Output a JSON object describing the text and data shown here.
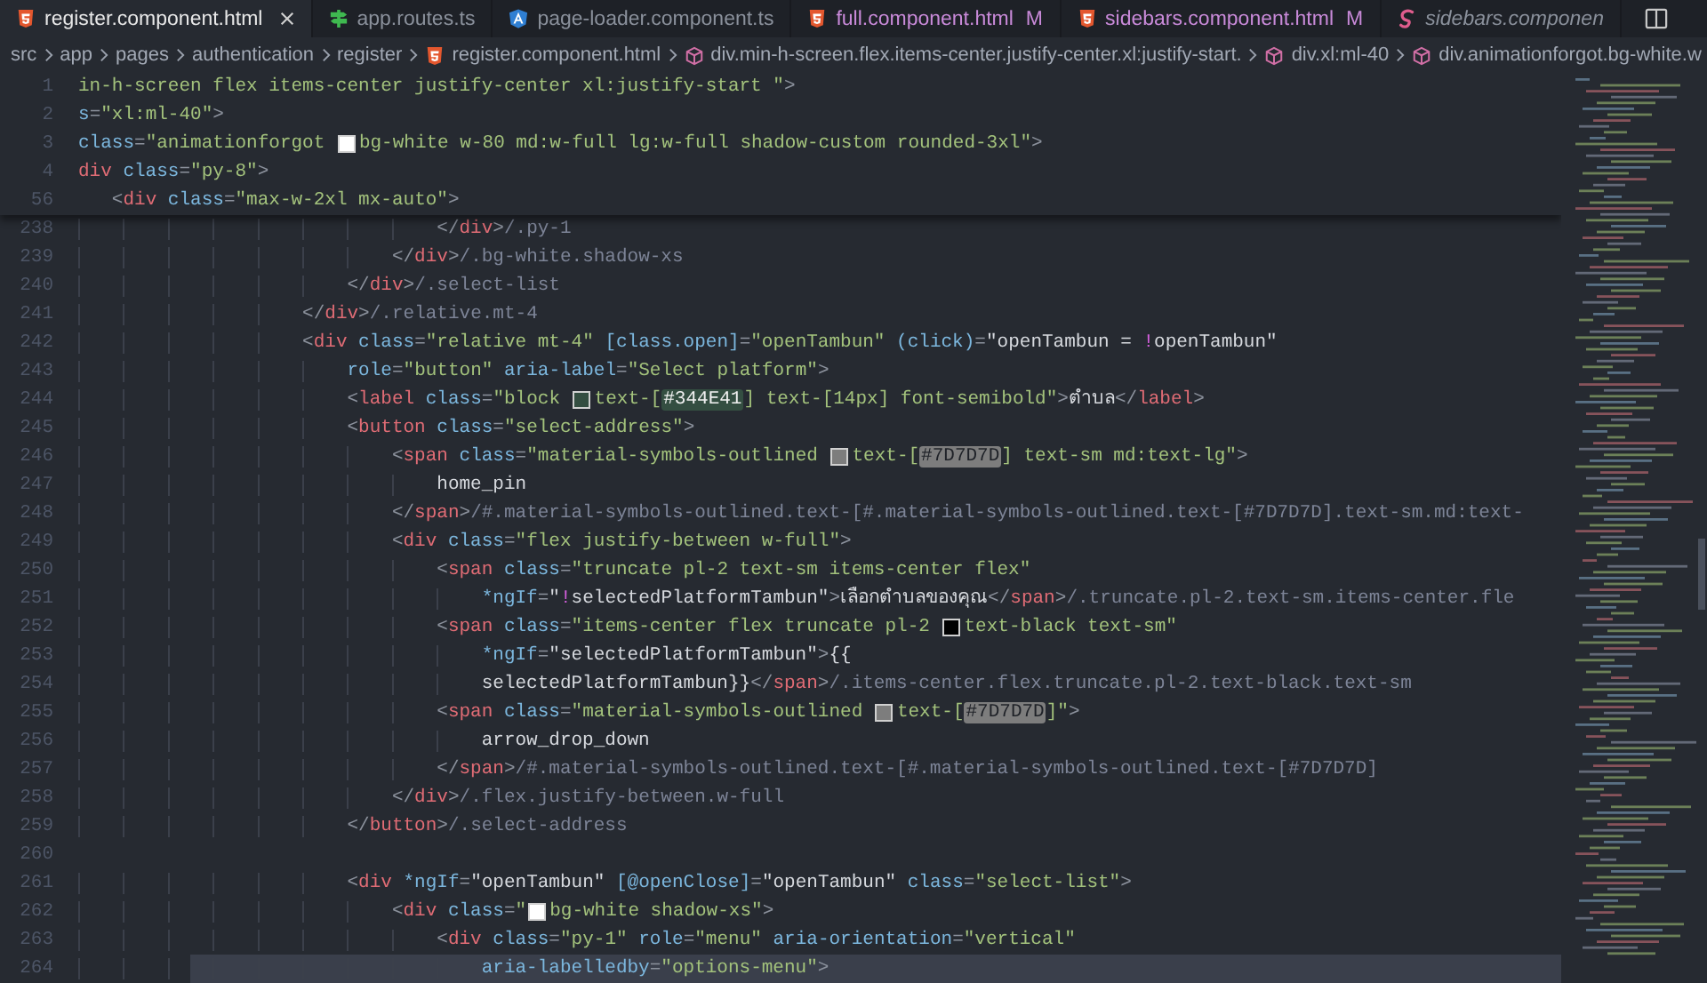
{
  "tabs": [
    {
      "label": "register.component.html",
      "kind": "html",
      "selected": true,
      "modified": false,
      "preview": false
    },
    {
      "label": "app.routes.ts",
      "kind": "routes",
      "selected": false,
      "modified": false,
      "preview": false
    },
    {
      "label": "page-loader.component.ts",
      "kind": "angular",
      "selected": false,
      "modified": false,
      "preview": false
    },
    {
      "label": "full.component.html",
      "kind": "html",
      "selected": false,
      "modified": true,
      "badge": "M",
      "preview": false
    },
    {
      "label": "sidebars.component.html",
      "kind": "html",
      "selected": false,
      "modified": true,
      "badge": "M",
      "preview": false
    },
    {
      "label": "sidebars.componen",
      "kind": "swirl",
      "selected": false,
      "modified": false,
      "preview": true
    }
  ],
  "breadcrumb": [
    {
      "label": "src",
      "kind": "folder"
    },
    {
      "label": "app",
      "kind": "folder"
    },
    {
      "label": "pages",
      "kind": "folder"
    },
    {
      "label": "authentication",
      "kind": "folder"
    },
    {
      "label": "register",
      "kind": "folder"
    },
    {
      "label": "register.component.html",
      "kind": "html"
    },
    {
      "label": "div.min-h-screen.flex.items-center.justify-center.xl:justify-start.",
      "kind": "element"
    },
    {
      "label": "div.xl:ml-40",
      "kind": "element"
    },
    {
      "label": "div.animationforgot.bg-white.w",
      "kind": "element"
    }
  ],
  "sticky_lines": [
    {
      "number": "1",
      "tokens": [
        {
          "kind": "str",
          "text": "in-h-screen flex items-center justify-center xl:justify-start \""
        },
        {
          "kind": "punct",
          "text": ">"
        }
      ]
    },
    {
      "number": "2",
      "tokens": [
        {
          "kind": "attr",
          "text": "s"
        },
        {
          "kind": "punct",
          "text": "="
        },
        {
          "kind": "str",
          "text": "\"xl:ml-40\""
        },
        {
          "kind": "punct",
          "text": ">"
        }
      ]
    },
    {
      "number": "3",
      "tokens": [
        {
          "kind": "attr",
          "text": "class"
        },
        {
          "kind": "punct",
          "text": "="
        },
        {
          "kind": "str",
          "text": "\"animationforgot "
        },
        {
          "kind": "swatch",
          "color": "#ffffff"
        },
        {
          "kind": "str",
          "text": "bg-white w-80 md:w-full lg:w-full shadow-custom rounded-3xl\""
        },
        {
          "kind": "punct",
          "text": ">"
        }
      ]
    },
    {
      "number": "4",
      "tokens": [
        {
          "kind": "tag",
          "text": "div"
        },
        {
          "kind": "attr",
          "text": " class"
        },
        {
          "kind": "punct",
          "text": "="
        },
        {
          "kind": "str",
          "text": "\"py-8\""
        },
        {
          "kind": "punct",
          "text": ">"
        }
      ]
    },
    {
      "number": "56",
      "tokens": [
        {
          "kind": "punct",
          "text": "   <"
        },
        {
          "kind": "tag",
          "text": "div"
        },
        {
          "kind": "attr",
          "text": " class"
        },
        {
          "kind": "punct",
          "text": "="
        },
        {
          "kind": "str",
          "text": "\"max-w-2xl mx-auto\""
        },
        {
          "kind": "punct",
          "text": ">"
        }
      ]
    }
  ],
  "lines": [
    {
      "number": "238",
      "highlighted": false,
      "tokens": [
        {
          "kind": "punct",
          "text": "                                </"
        },
        {
          "kind": "tag",
          "text": "div"
        },
        {
          "kind": "punct",
          "text": ">"
        },
        {
          "kind": "hint",
          "text": "/.py-1"
        }
      ]
    },
    {
      "number": "239",
      "highlighted": false,
      "tokens": [
        {
          "kind": "punct",
          "text": "                            </"
        },
        {
          "kind": "tag",
          "text": "div"
        },
        {
          "kind": "punct",
          "text": ">"
        },
        {
          "kind": "hint",
          "text": "/.bg-white.shadow-xs"
        }
      ]
    },
    {
      "number": "240",
      "highlighted": false,
      "tokens": [
        {
          "kind": "punct",
          "text": "                        </"
        },
        {
          "kind": "tag",
          "text": "div"
        },
        {
          "kind": "punct",
          "text": ">"
        },
        {
          "kind": "hint",
          "text": "/.select-list"
        }
      ]
    },
    {
      "number": "241",
      "highlighted": false,
      "tokens": [
        {
          "kind": "punct",
          "text": "                    </"
        },
        {
          "kind": "tag",
          "text": "div"
        },
        {
          "kind": "punct",
          "text": ">"
        },
        {
          "kind": "hint",
          "text": "/.relative.mt-4"
        }
      ]
    },
    {
      "number": "242",
      "highlighted": false,
      "tokens": [
        {
          "kind": "punct",
          "text": "                    <"
        },
        {
          "kind": "tag",
          "text": "div"
        },
        {
          "kind": "attr",
          "text": " class"
        },
        {
          "kind": "punct",
          "text": "="
        },
        {
          "kind": "str",
          "text": "\"relative mt-4\""
        },
        {
          "kind": "attr",
          "text": " [class.open]"
        },
        {
          "kind": "punct",
          "text": "="
        },
        {
          "kind": "str",
          "text": "\"openTambun\""
        },
        {
          "kind": "attr",
          "text": " (click)"
        },
        {
          "kind": "punct",
          "text": "="
        },
        {
          "kind": "text",
          "text": "\"openTambun = "
        },
        {
          "kind": "op",
          "text": "!"
        },
        {
          "kind": "text",
          "text": "openTambun\""
        }
      ]
    },
    {
      "number": "243",
      "highlighted": false,
      "tokens": [
        {
          "kind": "attr",
          "text": "                        role"
        },
        {
          "kind": "punct",
          "text": "="
        },
        {
          "kind": "str",
          "text": "\"button\""
        },
        {
          "kind": "attr",
          "text": " aria-label"
        },
        {
          "kind": "punct",
          "text": "="
        },
        {
          "kind": "str",
          "text": "\"Select platform\""
        },
        {
          "kind": "punct",
          "text": ">"
        }
      ]
    },
    {
      "number": "244",
      "highlighted": false,
      "tokens": [
        {
          "kind": "punct",
          "text": "                        <"
        },
        {
          "kind": "tag",
          "text": "label"
        },
        {
          "kind": "attr",
          "text": " class"
        },
        {
          "kind": "punct",
          "text": "="
        },
        {
          "kind": "str",
          "text": "\"block "
        },
        {
          "kind": "swatch",
          "color": "#344e41"
        },
        {
          "kind": "str",
          "text": "text-["
        },
        {
          "kind": "mark",
          "text": "#344E41",
          "color": "#344e41"
        },
        {
          "kind": "str",
          "text": "] text-[14px] font-semibold\""
        },
        {
          "kind": "punct",
          "text": ">"
        },
        {
          "kind": "text",
          "text": "ตำบล"
        },
        {
          "kind": "punct",
          "text": "</"
        },
        {
          "kind": "tag",
          "text": "label"
        },
        {
          "kind": "punct",
          "text": ">"
        }
      ]
    },
    {
      "number": "245",
      "highlighted": false,
      "tokens": [
        {
          "kind": "punct",
          "text": "                        <"
        },
        {
          "kind": "tag",
          "text": "button"
        },
        {
          "kind": "attr",
          "text": " class"
        },
        {
          "kind": "punct",
          "text": "="
        },
        {
          "kind": "str",
          "text": "\"select-address\""
        },
        {
          "kind": "punct",
          "text": ">"
        }
      ]
    },
    {
      "number": "246",
      "highlighted": false,
      "tokens": [
        {
          "kind": "punct",
          "text": "                            <"
        },
        {
          "kind": "tag",
          "text": "span"
        },
        {
          "kind": "attr",
          "text": " class"
        },
        {
          "kind": "punct",
          "text": "="
        },
        {
          "kind": "str",
          "text": "\"material-symbols-outlined "
        },
        {
          "kind": "swatch",
          "color": "#7d7d7d"
        },
        {
          "kind": "str",
          "text": "text-["
        },
        {
          "kind": "mark",
          "text": "#7D7D7D",
          "color": "#7d7d7d"
        },
        {
          "kind": "str",
          "text": "] text-sm md:text-lg\""
        },
        {
          "kind": "punct",
          "text": ">"
        }
      ]
    },
    {
      "number": "247",
      "highlighted": false,
      "tokens": [
        {
          "kind": "text",
          "text": "                                home_pin"
        }
      ]
    },
    {
      "number": "248",
      "highlighted": false,
      "tokens": [
        {
          "kind": "punct",
          "text": "                            </"
        },
        {
          "kind": "tag",
          "text": "span"
        },
        {
          "kind": "punct",
          "text": ">"
        },
        {
          "kind": "hint",
          "text": "/#.material-symbols-outlined.text-[#.material-symbols-outlined.text-[#7D7D7D].text-sm.md:text-"
        }
      ]
    },
    {
      "number": "249",
      "highlighted": false,
      "tokens": [
        {
          "kind": "punct",
          "text": "                            <"
        },
        {
          "kind": "tag",
          "text": "div"
        },
        {
          "kind": "attr",
          "text": " class"
        },
        {
          "kind": "punct",
          "text": "="
        },
        {
          "kind": "str",
          "text": "\"flex justify-between w-full\""
        },
        {
          "kind": "punct",
          "text": ">"
        }
      ]
    },
    {
      "number": "250",
      "highlighted": false,
      "tokens": [
        {
          "kind": "punct",
          "text": "                                <"
        },
        {
          "kind": "tag",
          "text": "span"
        },
        {
          "kind": "attr",
          "text": " class"
        },
        {
          "kind": "punct",
          "text": "="
        },
        {
          "kind": "str",
          "text": "\"truncate pl-2 text-sm items-center flex\""
        }
      ]
    },
    {
      "number": "251",
      "highlighted": false,
      "tokens": [
        {
          "kind": "attr",
          "text": "                                    *ngIf"
        },
        {
          "kind": "punct",
          "text": "="
        },
        {
          "kind": "text",
          "text": "\""
        },
        {
          "kind": "op",
          "text": "!"
        },
        {
          "kind": "text",
          "text": "selectedPlatformTambun\""
        },
        {
          "kind": "punct",
          "text": ">"
        },
        {
          "kind": "text",
          "text": "เลือกตำบลของคุณ"
        },
        {
          "kind": "punct",
          "text": "</"
        },
        {
          "kind": "tag",
          "text": "span"
        },
        {
          "kind": "punct",
          "text": ">"
        },
        {
          "kind": "hint",
          "text": "/.truncate.pl-2.text-sm.items-center.fle"
        }
      ]
    },
    {
      "number": "252",
      "highlighted": false,
      "tokens": [
        {
          "kind": "punct",
          "text": "                                <"
        },
        {
          "kind": "tag",
          "text": "span"
        },
        {
          "kind": "attr",
          "text": " class"
        },
        {
          "kind": "punct",
          "text": "="
        },
        {
          "kind": "str",
          "text": "\"items-center flex truncate pl-2 "
        },
        {
          "kind": "swatch",
          "color": "#000000"
        },
        {
          "kind": "str",
          "text": "text-black text-sm\""
        }
      ]
    },
    {
      "number": "253",
      "highlighted": false,
      "tokens": [
        {
          "kind": "attr",
          "text": "                                    *ngIf"
        },
        {
          "kind": "punct",
          "text": "="
        },
        {
          "kind": "text",
          "text": "\"selectedPlatformTambun\""
        },
        {
          "kind": "punct",
          "text": ">"
        },
        {
          "kind": "text",
          "text": "{{"
        }
      ]
    },
    {
      "number": "254",
      "highlighted": false,
      "tokens": [
        {
          "kind": "text",
          "text": "                                    selectedPlatformTambun}}"
        },
        {
          "kind": "punct",
          "text": "</"
        },
        {
          "kind": "tag",
          "text": "span"
        },
        {
          "kind": "punct",
          "text": ">"
        },
        {
          "kind": "hint",
          "text": "/.items-center.flex.truncate.pl-2.text-black.text-sm"
        }
      ]
    },
    {
      "number": "255",
      "highlighted": false,
      "tokens": [
        {
          "kind": "punct",
          "text": "                                <"
        },
        {
          "kind": "tag",
          "text": "span"
        },
        {
          "kind": "attr",
          "text": " class"
        },
        {
          "kind": "punct",
          "text": "="
        },
        {
          "kind": "str",
          "text": "\"material-symbols-outlined "
        },
        {
          "kind": "swatch",
          "color": "#7d7d7d"
        },
        {
          "kind": "str",
          "text": "text-["
        },
        {
          "kind": "mark",
          "text": "#7D7D7D",
          "color": "#7d7d7d"
        },
        {
          "kind": "str",
          "text": "]\""
        },
        {
          "kind": "punct",
          "text": ">"
        }
      ]
    },
    {
      "number": "256",
      "highlighted": false,
      "tokens": [
        {
          "kind": "text",
          "text": "                                    arrow_drop_down"
        }
      ]
    },
    {
      "number": "257",
      "highlighted": false,
      "tokens": [
        {
          "kind": "punct",
          "text": "                                </"
        },
        {
          "kind": "tag",
          "text": "span"
        },
        {
          "kind": "punct",
          "text": ">"
        },
        {
          "kind": "hint",
          "text": "/#.material-symbols-outlined.text-[#.material-symbols-outlined.text-[#7D7D7D]"
        }
      ]
    },
    {
      "number": "258",
      "highlighted": false,
      "tokens": [
        {
          "kind": "punct",
          "text": "                            </"
        },
        {
          "kind": "tag",
          "text": "div"
        },
        {
          "kind": "punct",
          "text": ">"
        },
        {
          "kind": "hint",
          "text": "/.flex.justify-between.w-full"
        }
      ]
    },
    {
      "number": "259",
      "highlighted": false,
      "tokens": [
        {
          "kind": "punct",
          "text": "                        </"
        },
        {
          "kind": "tag",
          "text": "button"
        },
        {
          "kind": "punct",
          "text": ">"
        },
        {
          "kind": "hint",
          "text": "/.select-address"
        }
      ]
    },
    {
      "number": "260",
      "highlighted": false
    },
    {
      "number": "261",
      "highlighted": false,
      "tokens": [
        {
          "kind": "punct",
          "text": "                        <"
        },
        {
          "kind": "tag",
          "text": "div"
        },
        {
          "kind": "attr",
          "text": " *ngIf"
        },
        {
          "kind": "punct",
          "text": "="
        },
        {
          "kind": "text",
          "text": "\"openTambun\""
        },
        {
          "kind": "attr",
          "text": " [@openClose]"
        },
        {
          "kind": "punct",
          "text": "="
        },
        {
          "kind": "text",
          "text": "\"openTambun\""
        },
        {
          "kind": "attr",
          "text": " class"
        },
        {
          "kind": "punct",
          "text": "="
        },
        {
          "kind": "str",
          "text": "\"select-list\""
        },
        {
          "kind": "punct",
          "text": ">"
        }
      ]
    },
    {
      "number": "262",
      "highlighted": false,
      "tokens": [
        {
          "kind": "punct",
          "text": "                            <"
        },
        {
          "kind": "tag",
          "text": "div"
        },
        {
          "kind": "attr",
          "text": " class"
        },
        {
          "kind": "punct",
          "text": "="
        },
        {
          "kind": "str",
          "text": "\""
        },
        {
          "kind": "swatch",
          "color": "#ffffff"
        },
        {
          "kind": "str",
          "text": "bg-white shadow-xs\""
        },
        {
          "kind": "punct",
          "text": ">"
        }
      ]
    },
    {
      "number": "263",
      "highlighted": false,
      "tokens": [
        {
          "kind": "punct",
          "text": "                                <"
        },
        {
          "kind": "tag",
          "text": "div"
        },
        {
          "kind": "attr",
          "text": " class"
        },
        {
          "kind": "punct",
          "text": "="
        },
        {
          "kind": "str",
          "text": "\"py-1\""
        },
        {
          "kind": "attr",
          "text": " role"
        },
        {
          "kind": "punct",
          "text": "="
        },
        {
          "kind": "str",
          "text": "\"menu\""
        },
        {
          "kind": "attr",
          "text": " aria-orientation"
        },
        {
          "kind": "punct",
          "text": "="
        },
        {
          "kind": "str",
          "text": "\"vertical\""
        }
      ]
    },
    {
      "number": "264",
      "highlighted": true,
      "tokens": [
        {
          "kind": "attr",
          "text": "                                    aria-labelledby"
        },
        {
          "kind": "punct",
          "text": "="
        },
        {
          "kind": "str",
          "text": "\"options-menu\""
        },
        {
          "kind": "punct",
          "text": ">"
        }
      ]
    }
  ]
}
